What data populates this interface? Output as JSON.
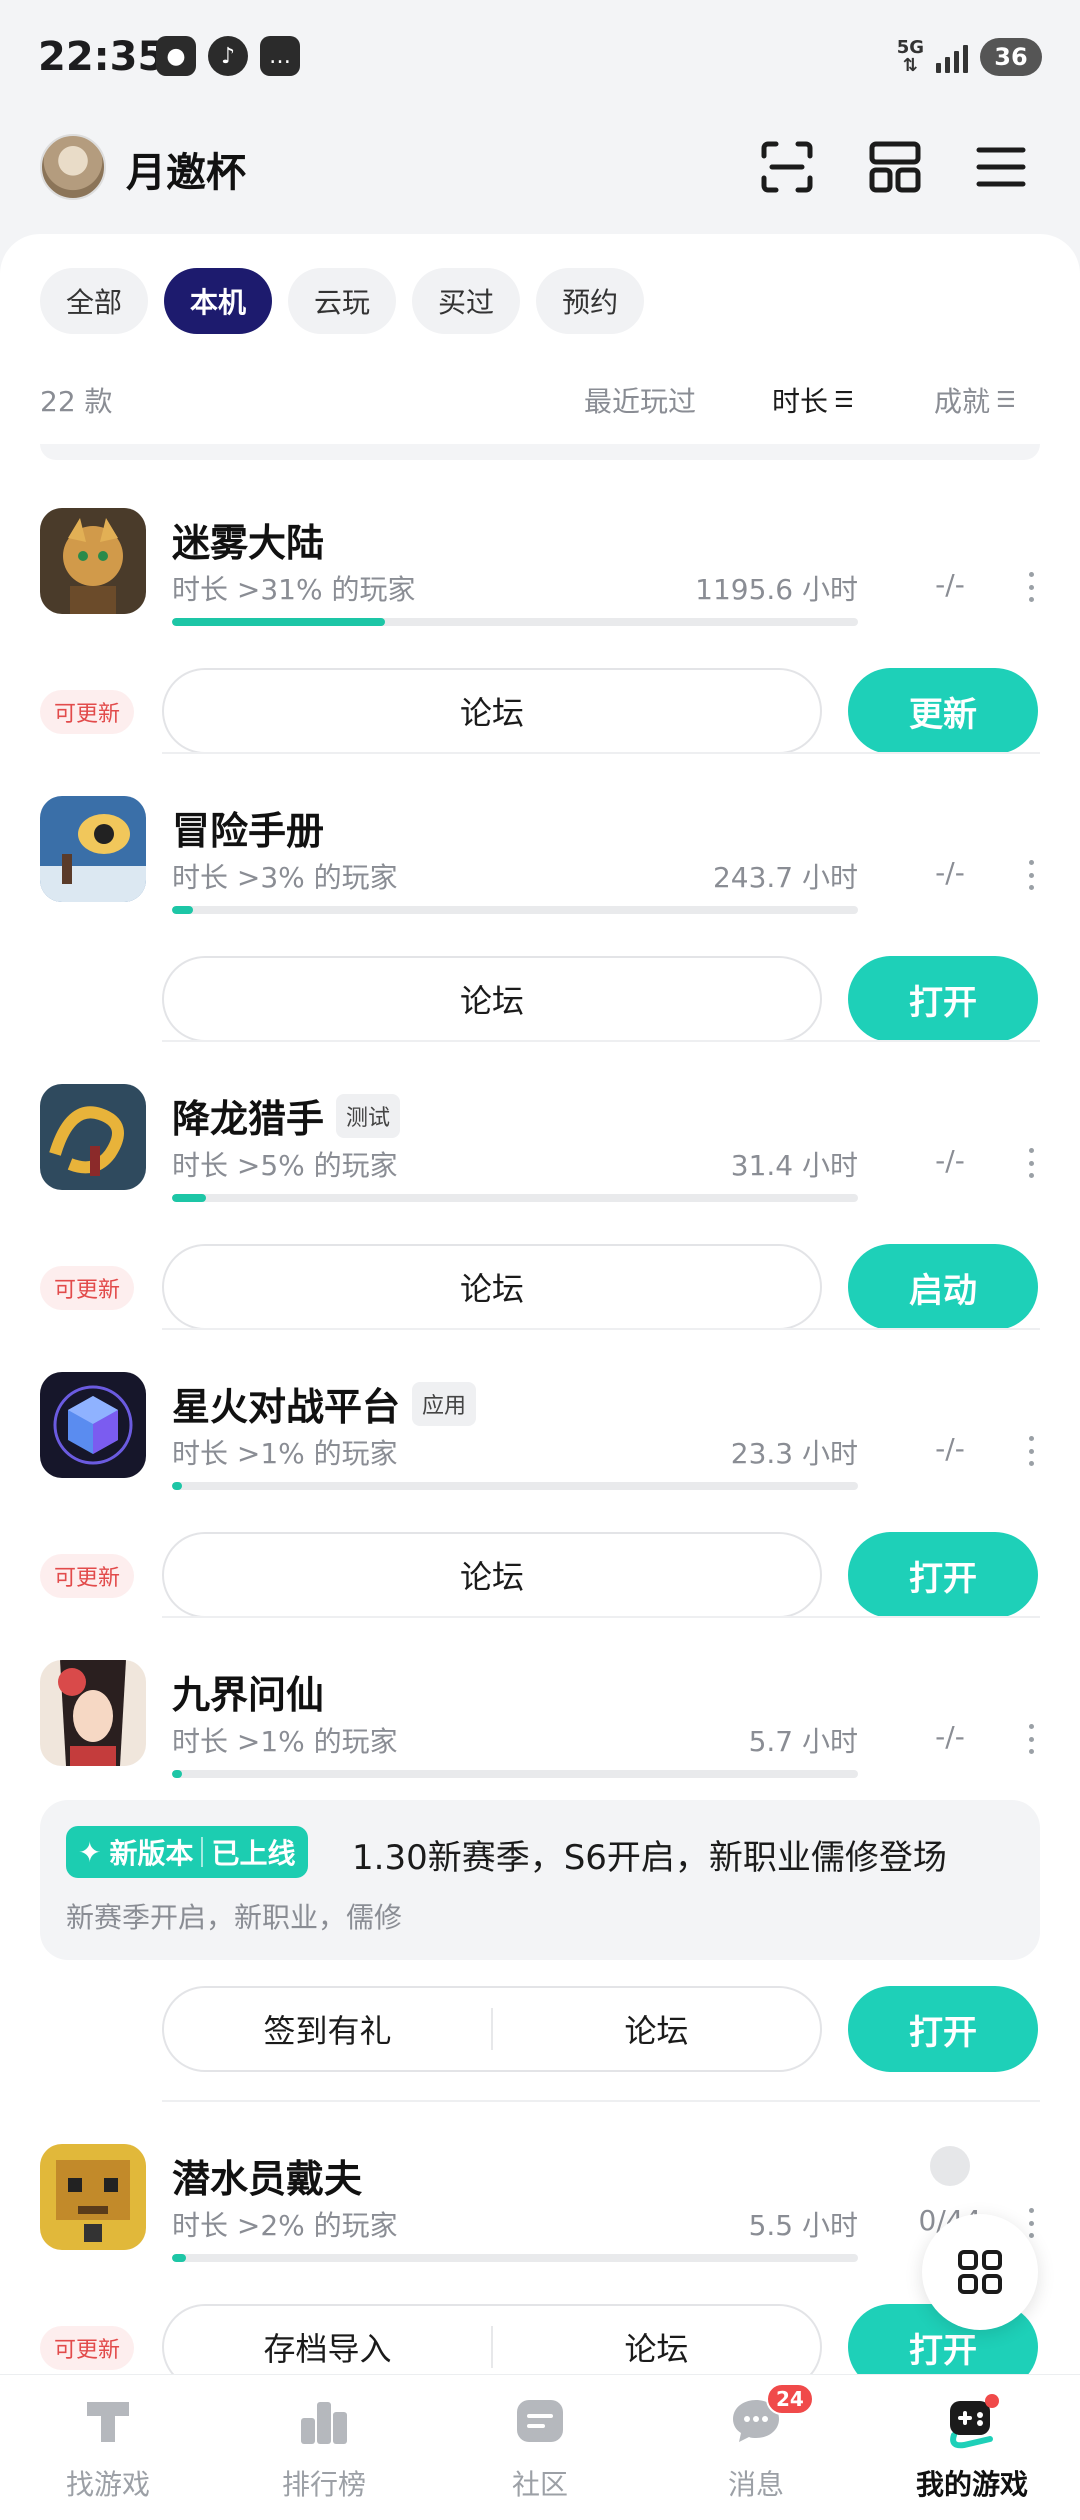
{
  "status_bar": {
    "time": "22:35",
    "network": "5G",
    "battery": "36",
    "icons": [
      "wechat-icon",
      "app-icon",
      "message-icon"
    ]
  },
  "header": {
    "username": "月邀杯",
    "icons": [
      "scan-icon",
      "grid-icon",
      "menu-icon"
    ]
  },
  "filters": [
    {
      "label": "全部",
      "active": false
    },
    {
      "label": "本机",
      "active": true
    },
    {
      "label": "云玩",
      "active": false
    },
    {
      "label": "买过",
      "active": false
    },
    {
      "label": "预约",
      "active": false
    }
  ],
  "list_header": {
    "count": "22 款",
    "sort_recent": "最近玩过",
    "sort_duration": "时长",
    "sort_achievement": "成就"
  },
  "games": [
    {
      "name": "迷雾大陆",
      "tag": "",
      "sub": "时长 >31% 的玩家",
      "hours": "1195.6 小时",
      "achievement": "-/-",
      "progress": 0.31,
      "update": "可更新",
      "action": "更新",
      "forum": "论坛"
    },
    {
      "name": "冒险手册",
      "tag": "",
      "sub": "时长 >3% 的玩家",
      "hours": "243.7 小时",
      "achievement": "-/-",
      "progress": 0.03,
      "update": "",
      "action": "打开",
      "forum": "论坛"
    },
    {
      "name": "降龙猎手",
      "tag": "测试",
      "sub": "时长 >5% 的玩家",
      "hours": "31.4 小时",
      "achievement": "-/-",
      "progress": 0.05,
      "update": "可更新",
      "action": "启动",
      "forum": "论坛"
    },
    {
      "name": "星火对战平台",
      "tag": "应用",
      "sub": "时长 >1% 的玩家",
      "hours": "23.3 小时",
      "achievement": "-/-",
      "progress": 0.01,
      "update": "可更新",
      "action": "打开",
      "forum": "论坛"
    },
    {
      "name": "九界问仙",
      "tag": "",
      "sub": "时长 >1% 的玩家",
      "hours": "5.7 小时",
      "achievement": "-/-",
      "progress": 0.01,
      "update": "",
      "action": "打开",
      "forum": "论坛",
      "extra_btn": "签到有礼"
    },
    {
      "name": "潜水员戴夫",
      "tag": "",
      "sub": "时长 >2% 的玩家",
      "hours": "5.5 小时",
      "achievement": "0/44",
      "progress": 0.02,
      "update": "可更新",
      "action": "打开",
      "forum": "论坛",
      "extra_btn": "存档导入"
    }
  ],
  "news": {
    "badge_new": "新版本",
    "badge_online": "已上线",
    "title": "1.30新赛季，S6开启，新职业儒修登场",
    "subtitle": "新赛季开启，新职业，儒修"
  },
  "bottom_nav": [
    {
      "label": "找游戏",
      "icon": "find-game-icon"
    },
    {
      "label": "排行榜",
      "icon": "ranking-icon"
    },
    {
      "label": "社区",
      "icon": "community-icon"
    },
    {
      "label": "消息",
      "icon": "message-icon",
      "badge": "24"
    },
    {
      "label": "我的游戏",
      "icon": "my-games-icon",
      "active": true
    }
  ],
  "colors": {
    "accent": "#1ed0b8",
    "active_chip": "#1d1b6e",
    "update_badge": "#e24b4b"
  }
}
